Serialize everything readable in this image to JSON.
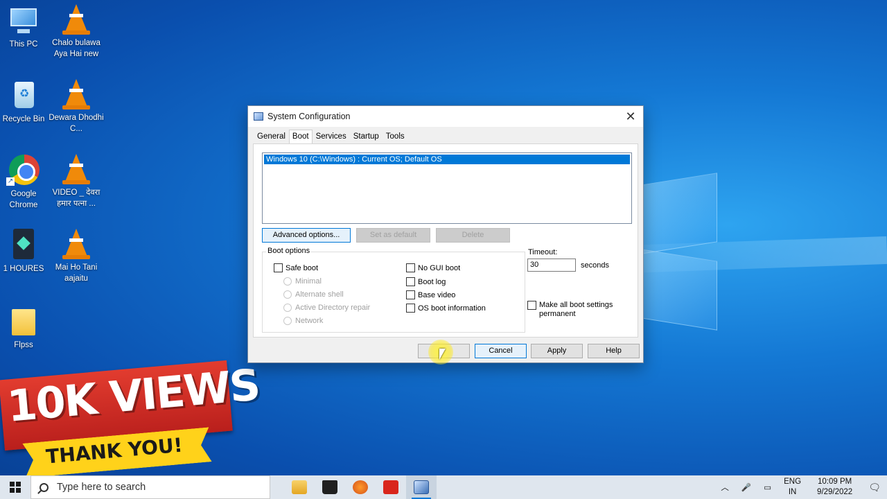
{
  "desktop": {
    "icons": [
      {
        "label": "This PC",
        "kind": "pc"
      },
      {
        "label": "Chalo bulawa Aya Hai new",
        "kind": "vlc"
      },
      {
        "label": "Recycle Bin",
        "kind": "bin"
      },
      {
        "label": "Dewara Dhodhi C...",
        "kind": "vlc"
      },
      {
        "label": "Google Chrome",
        "kind": "chrome"
      },
      {
        "label": "VIDEO _ देवरा हमार पत्ना ...",
        "kind": "vlc"
      },
      {
        "label": "1 HOURES",
        "kind": "filmora"
      },
      {
        "label": "Mai Ho Tani aajaitu",
        "kind": "vlc"
      },
      {
        "label": "Flpss",
        "kind": "folder"
      }
    ]
  },
  "banner": {
    "views": "10K VIEWS",
    "thanks": "THANK YOU!"
  },
  "dialog": {
    "title": "System Configuration",
    "close": "✕",
    "tabs": [
      "General",
      "Boot",
      "Services",
      "Startup",
      "Tools"
    ],
    "active_tab": "Boot",
    "os_entry": "Windows 10 (C:\\Windows) : Current OS; Default OS",
    "buttons": {
      "advanced": "Advanced options...",
      "set_default": "Set as default",
      "delete": "Delete"
    },
    "boot_options": {
      "title": "Boot options",
      "safe_boot": "Safe boot",
      "minimal": "Minimal",
      "alternate_shell": "Alternate shell",
      "ad_repair": "Active Directory repair",
      "network": "Network",
      "no_gui": "No GUI boot",
      "boot_log": "Boot log",
      "base_video": "Base video",
      "os_info": "OS boot information"
    },
    "timeout": {
      "label": "Timeout:",
      "value": "30",
      "unit": "seconds"
    },
    "make_permanent": "Make all boot settings permanent",
    "footer": {
      "ok": "",
      "cancel": "Cancel",
      "apply": "Apply",
      "help": "Help"
    }
  },
  "taskbar": {
    "search_placeholder": "Type here to search",
    "apps": [
      "file-explorer",
      "store",
      "fl-studio",
      "app-red",
      "msconfig"
    ],
    "lang_top": "ENG",
    "lang_bottom": "IN",
    "time": "10:09 PM",
    "date": "9/29/2022"
  },
  "colors": {
    "accent": "#0078d7",
    "banner_red": "#d62f26",
    "banner_yellow": "#ffd21a"
  }
}
